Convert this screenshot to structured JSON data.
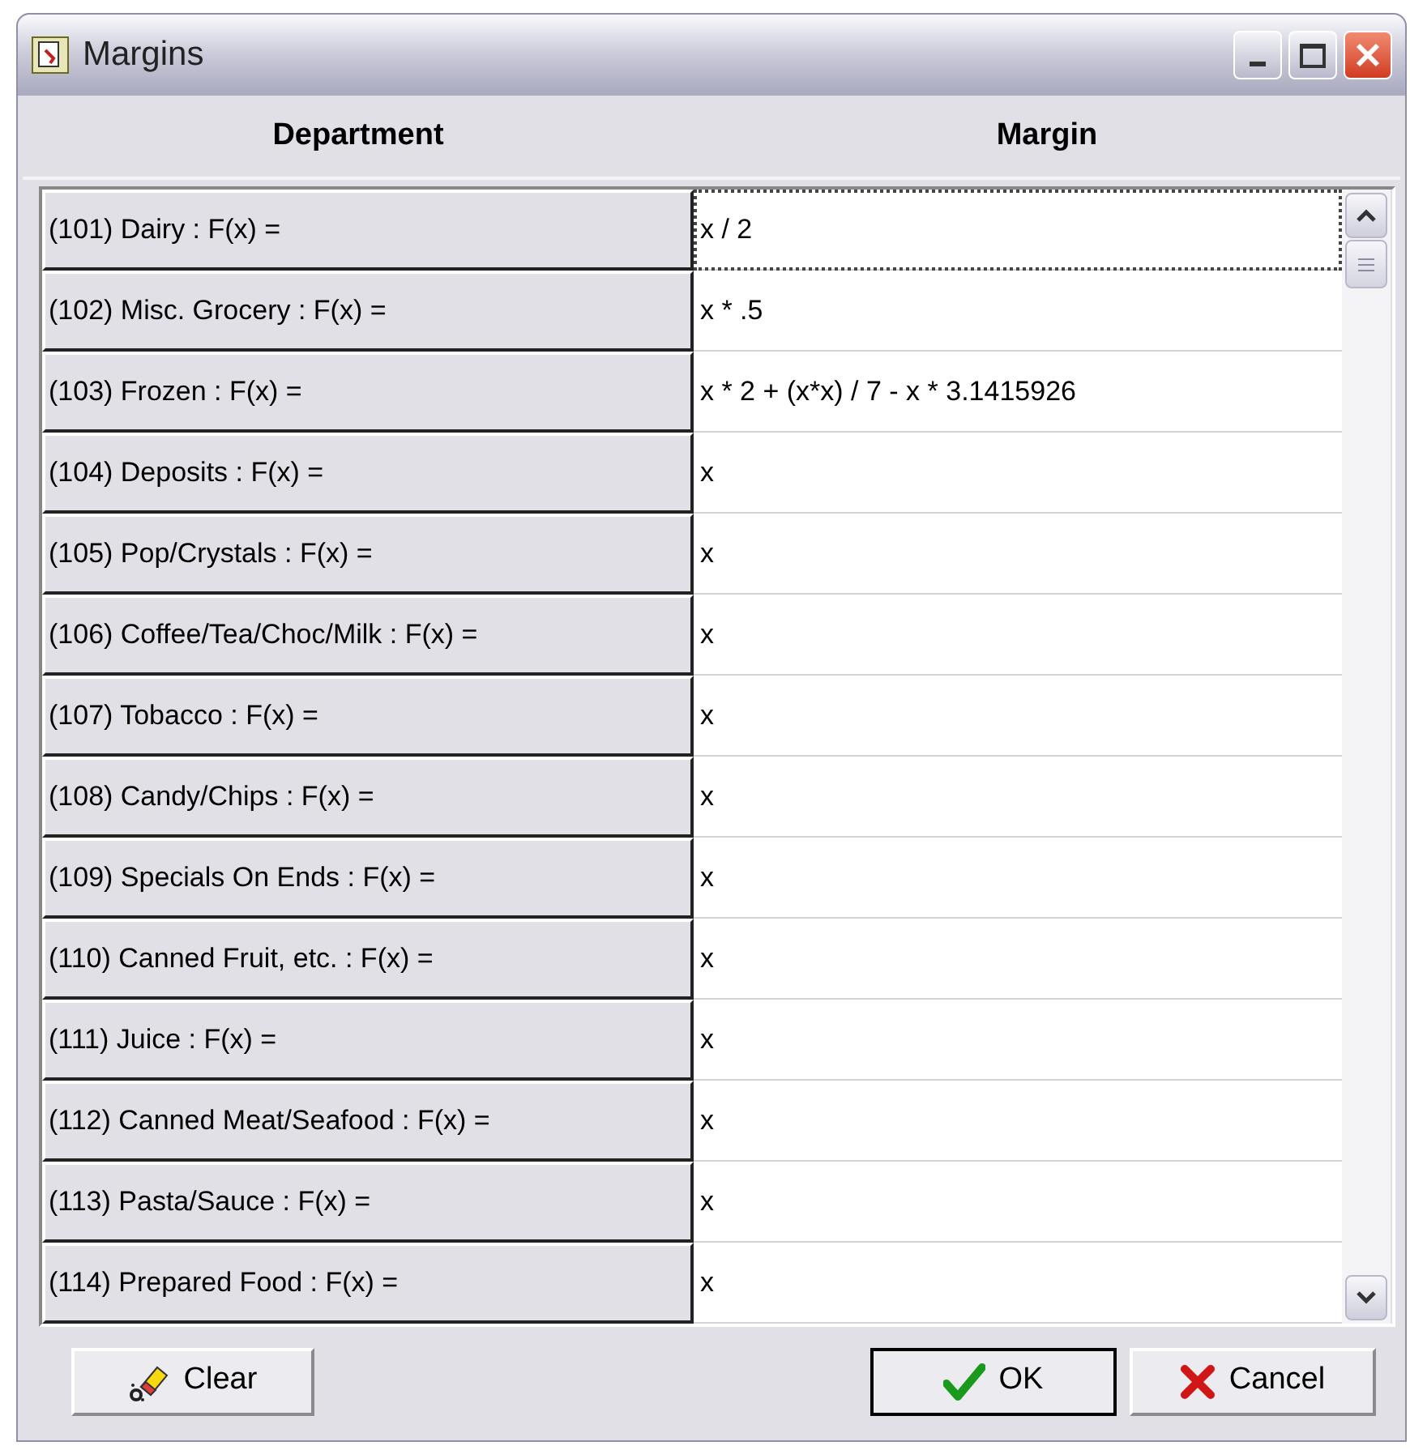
{
  "window": {
    "title": "Margins"
  },
  "columns": [
    "Department",
    "Margin"
  ],
  "rows": [
    {
      "department": "(101) Dairy : F(x) =",
      "margin": "x / 2",
      "focused": true
    },
    {
      "department": "(102) Misc. Grocery : F(x) =",
      "margin": "x * .5",
      "focused": false
    },
    {
      "department": "(103) Frozen : F(x) =",
      "margin": "x * 2 + (x*x) / 7 - x * 3.1415926",
      "focused": false
    },
    {
      "department": "(104) Deposits : F(x) =",
      "margin": "x",
      "focused": false
    },
    {
      "department": "(105) Pop/Crystals : F(x) =",
      "margin": "x",
      "focused": false
    },
    {
      "department": "(106) Coffee/Tea/Choc/Milk : F(x) =",
      "margin": "x",
      "focused": false
    },
    {
      "department": "(107) Tobacco : F(x) =",
      "margin": "x",
      "focused": false
    },
    {
      "department": "(108) Candy/Chips : F(x) =",
      "margin": "x",
      "focused": false
    },
    {
      "department": "(109) Specials On Ends : F(x) =",
      "margin": "x",
      "focused": false
    },
    {
      "department": "(110) Canned Fruit, etc. : F(x) =",
      "margin": "x",
      "focused": false
    },
    {
      "department": "(111) Juice : F(x) =",
      "margin": "x",
      "focused": false
    },
    {
      "department": "(112) Canned Meat/Seafood : F(x) =",
      "margin": "x",
      "focused": false
    },
    {
      "department": "(113) Pasta/Sauce : F(x) =",
      "margin": "x",
      "focused": false
    },
    {
      "department": "(114) Prepared Food : F(x) =",
      "margin": "x",
      "focused": false
    }
  ],
  "buttons": [
    {
      "label": "Clear",
      "kind": "clear",
      "default": false
    },
    {
      "label": "OK",
      "kind": "ok",
      "default": true
    },
    {
      "label": "Cancel",
      "kind": "cancel",
      "default": false
    }
  ]
}
